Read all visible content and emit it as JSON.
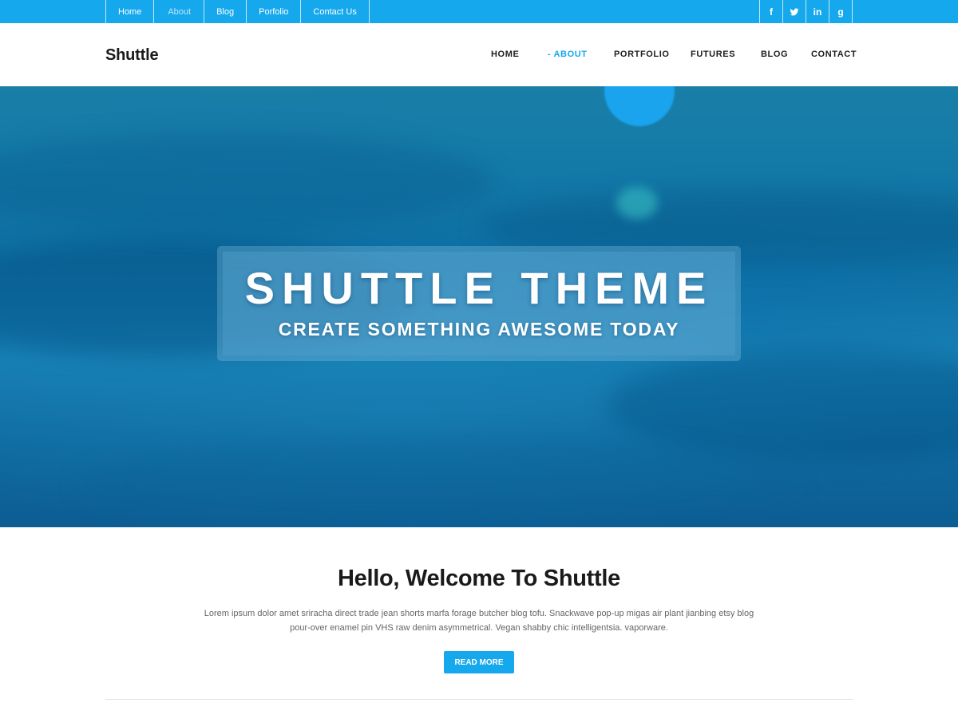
{
  "topbar": {
    "menu": [
      "Home",
      "About",
      "Blog",
      "Porfolio",
      "Contact Us"
    ],
    "social": [
      {
        "icon": "facebook-icon",
        "glyph": "f"
      },
      {
        "icon": "twitter-icon",
        "glyph": ""
      },
      {
        "icon": "linkedin-icon",
        "glyph": "in"
      },
      {
        "icon": "google-icon",
        "glyph": "g"
      }
    ]
  },
  "header": {
    "logo": "Shuttle",
    "nav": [
      "HOME",
      "- ABOUT",
      "PORTFOLIO",
      "FUTURES",
      "BLOG",
      "CONTACT"
    ],
    "active_index": 1
  },
  "hero": {
    "title": "SHUTTLE THEME",
    "subtitle": "CREATE SOMETHING AWESOME TODAY"
  },
  "welcome": {
    "title": "Hello, Welcome To Shuttle",
    "text_line1": "Lorem ipsum dolor amet sriracha direct trade jean shorts marfa forage butcher blog tofu. Snackwave pop-up migas air plant  jianbing etsy blog",
    "text_line2": "pour-over enamel pin VHS raw denim asymmetrical. Vegan shabby chic intelligentsia. vaporware.",
    "button": "READ MORE"
  },
  "colors": {
    "accent": "#16a8ec",
    "text_dark": "#1a1a1a",
    "text_muted": "#666666"
  }
}
